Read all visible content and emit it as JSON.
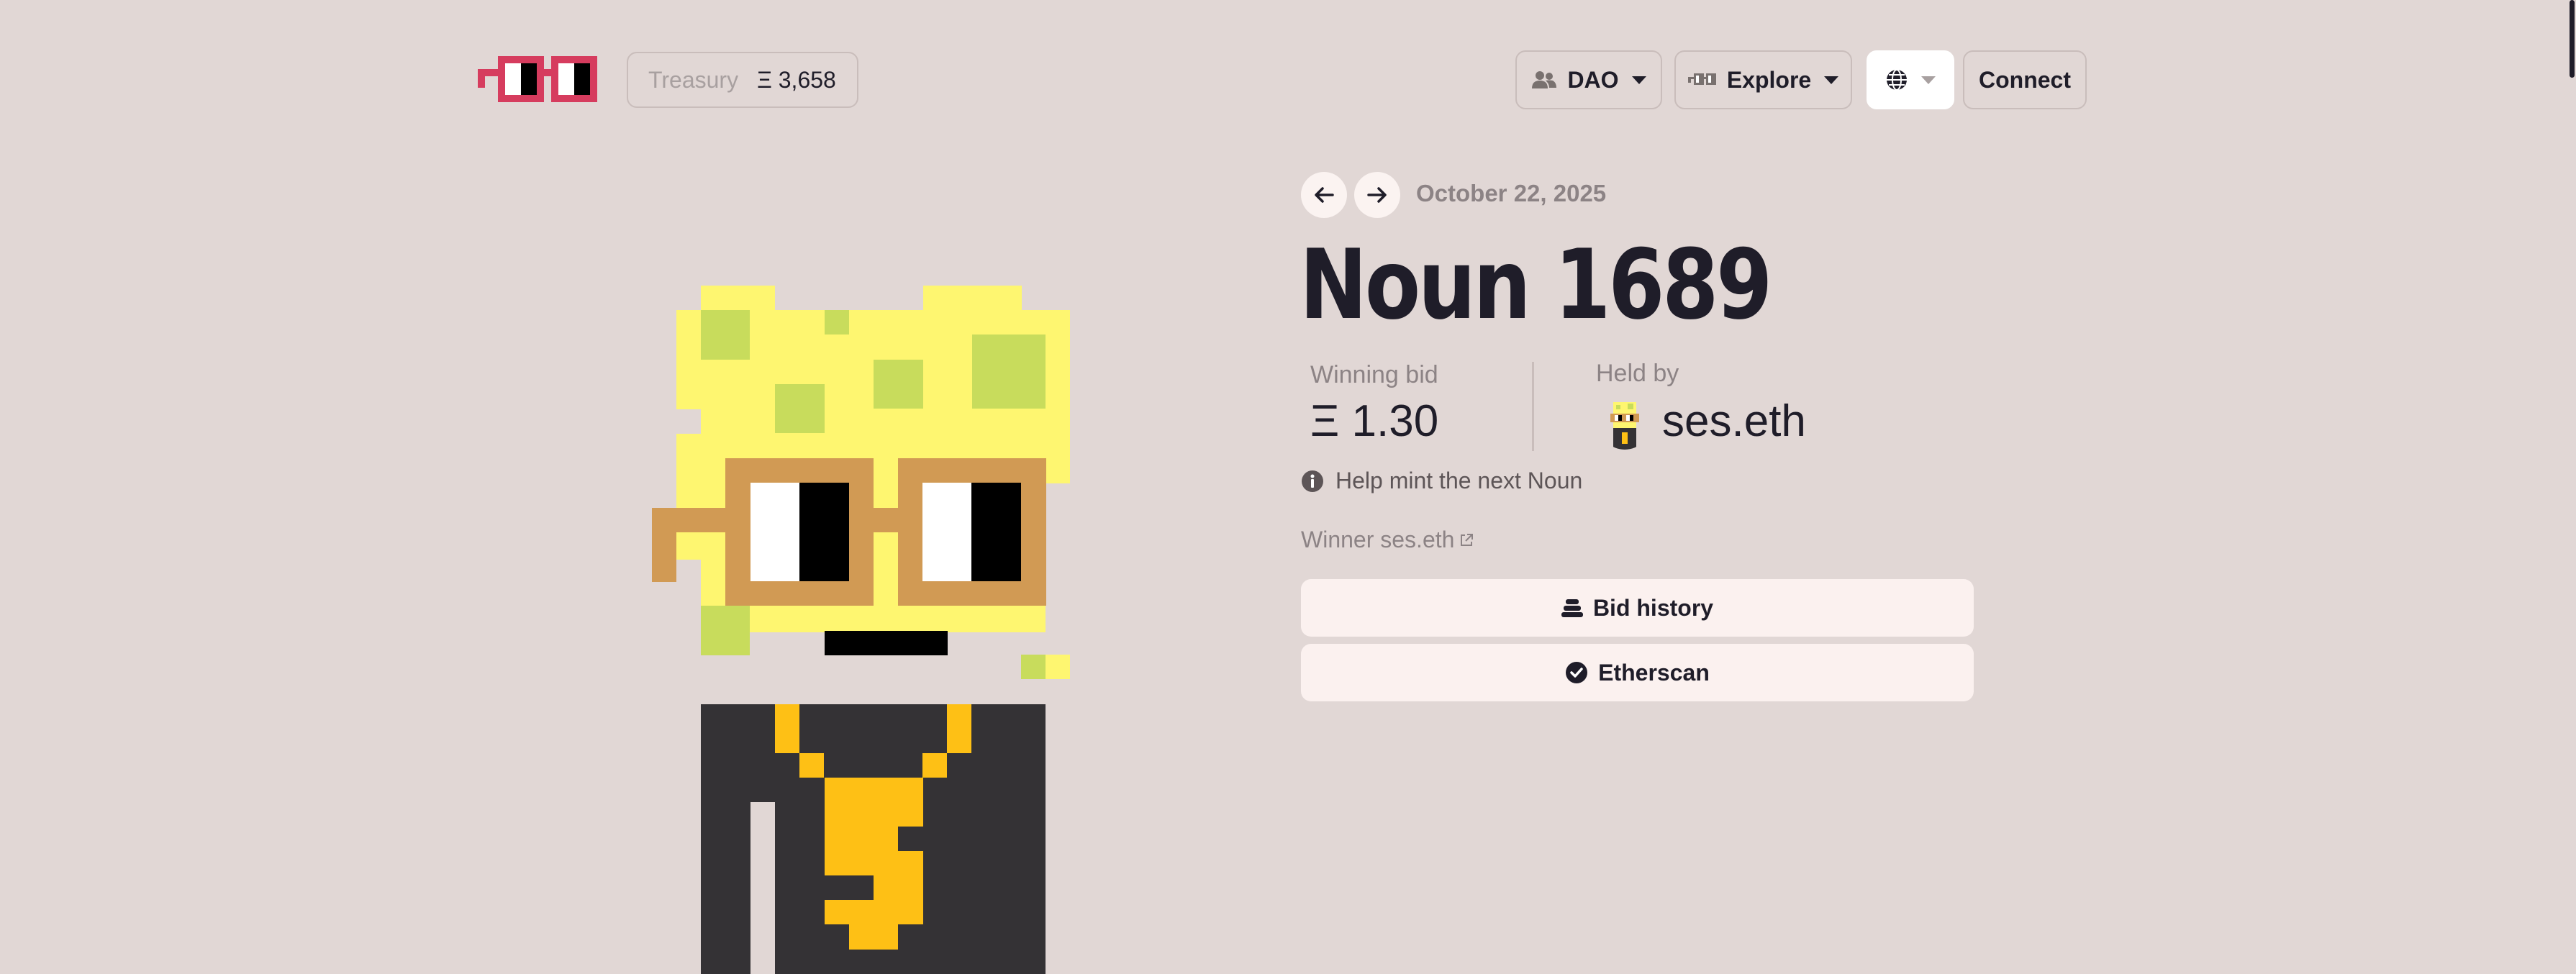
{
  "header": {
    "logo_icon": "noggles-logo",
    "treasury": {
      "label": "Treasury",
      "amount": "Ξ 3,658"
    },
    "nav": {
      "dao_label": "DAO",
      "explore_label": "Explore",
      "language_icon": "globe-icon",
      "connect_label": "Connect"
    }
  },
  "auction": {
    "date": "October 22, 2025",
    "title": "Noun 1689",
    "winning_bid_label": "Winning bid",
    "winning_bid_value": "Ξ 1.30",
    "held_by_label": "Held by",
    "holder_name": "ses.eth",
    "help_text": "Help mint the next Noun",
    "winner_text": "Winner ses.eth",
    "bid_history_label": "Bid history",
    "etherscan_label": "Etherscan"
  },
  "colors": {
    "background": "#e1d7d5",
    "noggles_red": "#d63c5e",
    "noun_head": "#fef670",
    "noun_spots": "#c8dc5c",
    "glasses_frame": "#d19a54",
    "body": "#343235",
    "necklace": "#fec015",
    "text_primary": "#1f1d29",
    "text_muted": "#8c8385"
  }
}
